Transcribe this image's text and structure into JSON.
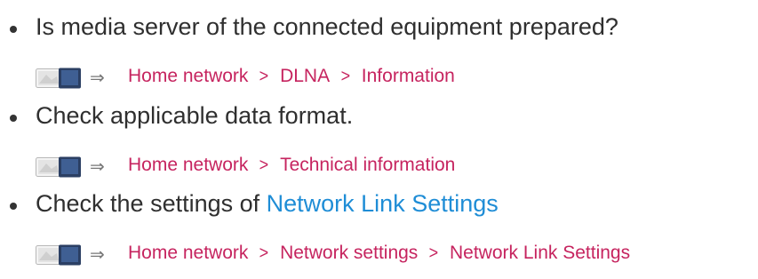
{
  "items": [
    {
      "text": "Is media server of the connected equipment prepared?",
      "path": [
        "Home network",
        "DLNA",
        "Information"
      ]
    },
    {
      "text": "Check applicable data format.",
      "path": [
        "Home network",
        "Technical information"
      ]
    },
    {
      "text": "Check the settings of ",
      "link": "Network Link Settings",
      "path": [
        "Home network",
        "Network settings",
        "Network Link Settings"
      ]
    }
  ],
  "separator": ">",
  "arrow": "⇒",
  "icons": {
    "menu": "menu-icon"
  },
  "colors": {
    "text": "#2f2f2f",
    "path": "#c6245f",
    "link": "#1f8dd6"
  }
}
